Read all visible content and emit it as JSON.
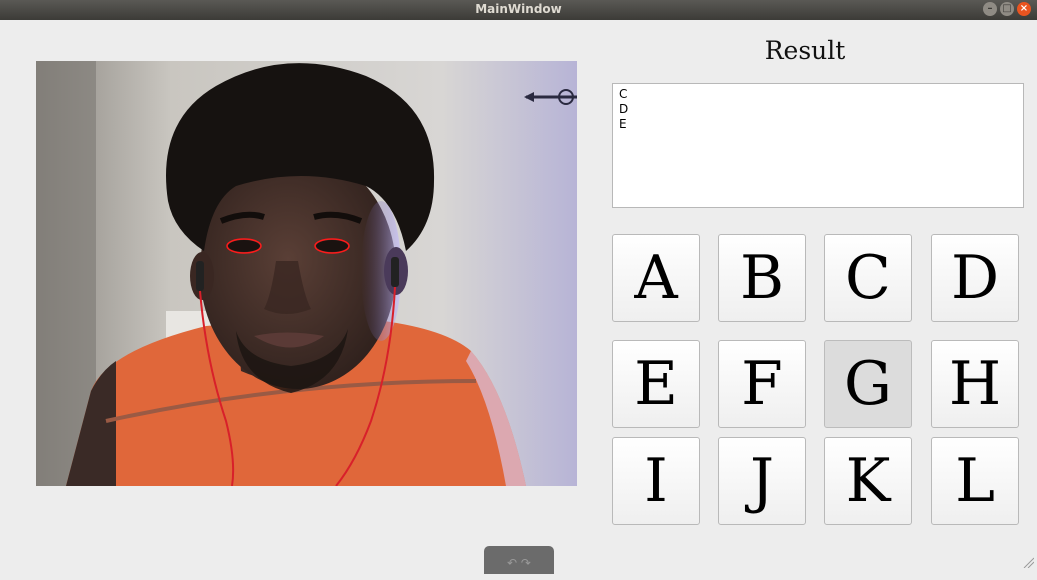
{
  "window": {
    "title": "MainWindow"
  },
  "result": {
    "title": "Result",
    "lines": [
      "C",
      "D",
      "E"
    ]
  },
  "keys": {
    "a": "A",
    "b": "B",
    "c": "C",
    "d": "D",
    "e": "E",
    "f": "F",
    "g": "G",
    "h": "H",
    "i": "I",
    "j": "J",
    "k": "K",
    "l": "L"
  },
  "hovered_key": "G",
  "bottom_tab": {
    "icons": [
      "undo-arrow-icon",
      "redo-arrow-icon"
    ]
  },
  "colors": {
    "titlebar": "#3c3b37",
    "close_button": "#e95420",
    "eye_outline": "#ff0000",
    "shirt": "#e0673a"
  }
}
